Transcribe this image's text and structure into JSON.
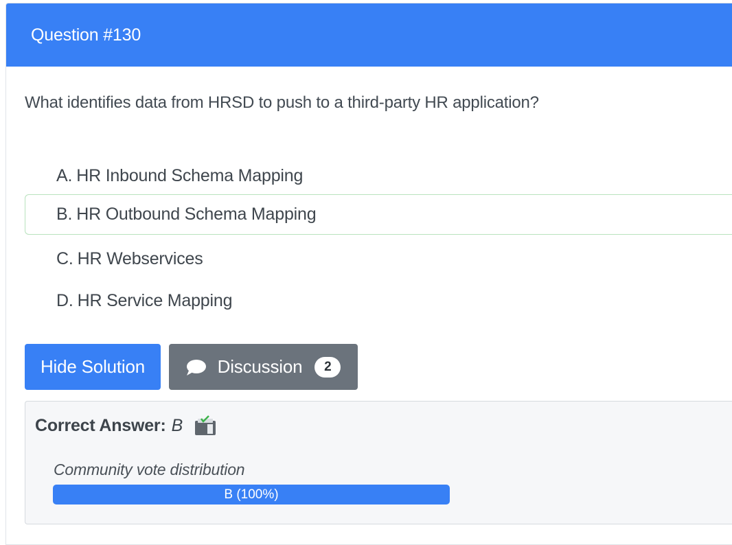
{
  "header": {
    "title": "Question #130"
  },
  "question": {
    "text": "What identifies data from HRSD to push to a third-party HR application?"
  },
  "choices": [
    {
      "letter": "A.",
      "text": "HR Inbound Schema Mapping",
      "correct": false
    },
    {
      "letter": "B.",
      "text": "HR Outbound Schema Mapping",
      "correct": true
    },
    {
      "letter": "C.",
      "text": "HR Webservices",
      "correct": false
    },
    {
      "letter": "D.",
      "text": "HR Service Mapping",
      "correct": false
    }
  ],
  "buttons": {
    "hide_solution": "Hide Solution",
    "discussion": "Discussion",
    "discussion_count": "2"
  },
  "answer": {
    "label": "Correct Answer:",
    "value": "B",
    "icon": "clipboard-check-icon"
  },
  "vote": {
    "label": "Community vote distribution",
    "bar_text": "B (100%)",
    "fraction": 1.0
  },
  "colors": {
    "primary": "#3880f5",
    "secondary": "#6b737c",
    "correct_border": "#b8e2bd",
    "answer_bg": "#f6f7f9"
  }
}
